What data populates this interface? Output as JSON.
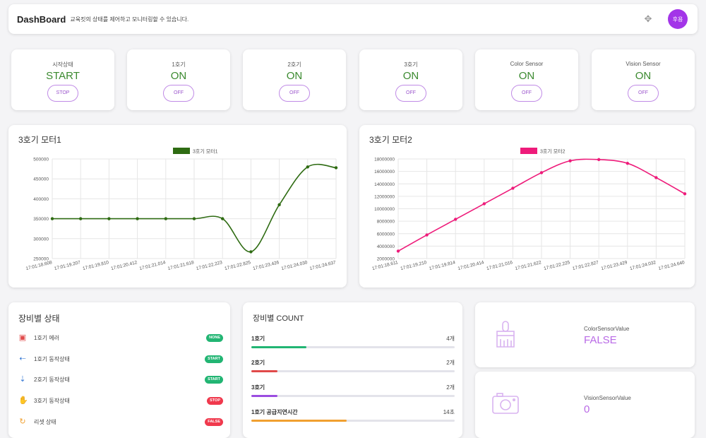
{
  "header": {
    "title": "DashBoard",
    "subtitle": "교육킷의 상태를 제어하고 모니터링할 수 있습니다.",
    "move_icon": "move-icon",
    "avatar_text": "후용"
  },
  "status_cards": [
    {
      "label": "시작상태",
      "value": "START",
      "button": "STOP"
    },
    {
      "label": "1호기",
      "value": "ON",
      "button": "OFF"
    },
    {
      "label": "2호기",
      "value": "ON",
      "button": "OFF"
    },
    {
      "label": "3호기",
      "value": "ON",
      "button": "OFF"
    },
    {
      "label": "Color Sensor",
      "value": "ON",
      "button": "OFF"
    },
    {
      "label": "Vision Sensor",
      "value": "ON",
      "button": "OFF"
    }
  ],
  "chart_data": [
    {
      "type": "line",
      "title": "3호기 모터1",
      "legend": "top",
      "grid": true,
      "color": "#2e6b12",
      "x": [
        "17:01:18.608",
        "17:01:19.207",
        "17:01:19.810",
        "17:01:20.412",
        "17:01:21.014",
        "17:01:21.618",
        "17:01:22.223",
        "17:01:22.825",
        "17:01:23.426",
        "17:01:24.030",
        "17:01:24.637"
      ],
      "series": [
        {
          "name": "3호기 모터1",
          "values": [
            350000,
            350000,
            350000,
            350000,
            350000,
            350000,
            350000,
            267000,
            385000,
            480000,
            478000
          ]
        }
      ],
      "yticks": [
        250000,
        300000,
        350000,
        400000,
        450000,
        500000
      ],
      "ylim": [
        250000,
        500000
      ]
    },
    {
      "type": "line",
      "title": "3호기 모터2",
      "legend": "top",
      "grid": true,
      "color": "#ee1b7a",
      "x": [
        "17:01:18.611",
        "17:01:19.210",
        "17:01:19.814",
        "17:01:20.414",
        "17:01:21.016",
        "17:01:21.622",
        "17:01:22.225",
        "17:01:22.827",
        "17:01:23.429",
        "17:01:24.032",
        "17:01:24.640"
      ],
      "series": [
        {
          "name": "3호기 모터2",
          "values": [
            3200000,
            5800000,
            8300000,
            10800000,
            13300000,
            15800000,
            17700000,
            17900000,
            17300000,
            15000000,
            12400000
          ]
        }
      ],
      "yticks": [
        2000000,
        4000000,
        6000000,
        8000000,
        10000000,
        12000000,
        14000000,
        16000000,
        18000000
      ],
      "ylim": [
        2000000,
        18000000
      ]
    }
  ],
  "equipment_status": {
    "title": "장비별 상태",
    "rows": [
      {
        "icon": "calendar-icon",
        "icon_color": "#e04a4a",
        "label": "1호기 에러",
        "badge": "NONE",
        "badge_color": "#22b573"
      },
      {
        "icon": "arrow-left-icon",
        "icon_color": "#3a7bd5",
        "label": "1호기 동작상태",
        "badge": "START",
        "badge_color": "#22b573"
      },
      {
        "icon": "arrow-down-icon",
        "icon_color": "#3a7bd5",
        "label": "2호기 동작상태",
        "badge": "START",
        "badge_color": "#22b573"
      },
      {
        "icon": "hand-icon",
        "icon_color": "#3a7bd5",
        "label": "3호기 동작상태",
        "badge": "STOP",
        "badge_color": "#f0394d"
      },
      {
        "icon": "reset-icon",
        "icon_color": "#f0a030",
        "label": "리셋 상태",
        "badge": "FALSE",
        "badge_color": "#f0394d"
      }
    ]
  },
  "equipment_count": {
    "title": "장비별 COUNT",
    "rows": [
      {
        "label": "1호기",
        "value": "4개",
        "progress": 0.27,
        "color": "#22b573"
      },
      {
        "label": "2호기",
        "value": "2개",
        "progress": 0.13,
        "color": "#e04a4a"
      },
      {
        "label": "3호기",
        "value": "2개",
        "progress": 0.13,
        "color": "#9b4de0"
      },
      {
        "label": "1호기 공급지연시간",
        "value": "14초",
        "progress": 0.47,
        "color": "#f0a030"
      }
    ]
  },
  "sensors": [
    {
      "icon": "paintbrush-icon",
      "label": "ColorSensorValue",
      "value": "FALSE"
    },
    {
      "icon": "camera-icon",
      "label": "VisionSensorValue",
      "value": "0"
    }
  ]
}
